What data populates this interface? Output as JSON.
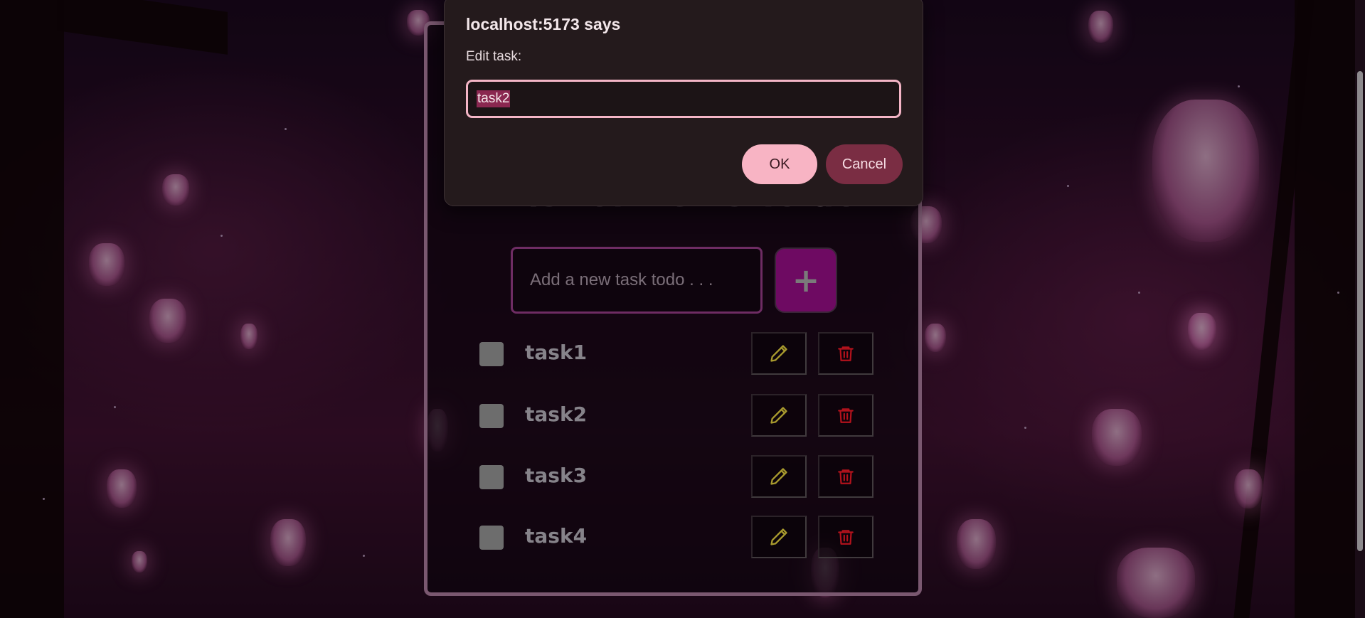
{
  "dialog": {
    "title": "localhost:5173 says",
    "message": "Edit task:",
    "input_value": "task2",
    "ok_label": "OK",
    "cancel_label": "Cancel"
  },
  "app": {
    "title": "List of Items To do",
    "new_task_placeholder": "Add a new task todo . . .",
    "add_button_label": "+",
    "tasks": [
      {
        "label": "task1",
        "checked": false
      },
      {
        "label": "task2",
        "checked": false
      },
      {
        "label": "task3",
        "checked": false
      },
      {
        "label": "task4",
        "checked": false
      }
    ]
  },
  "icons": {
    "edit": "pencil-icon",
    "delete": "trash-icon"
  },
  "colors": {
    "accent": "#6e0a62",
    "dialog_ok": "#f8b4c4",
    "dialog_cancel": "#7a2d43",
    "edit_icon": "#a89a2e",
    "delete_icon": "#b3121c"
  }
}
